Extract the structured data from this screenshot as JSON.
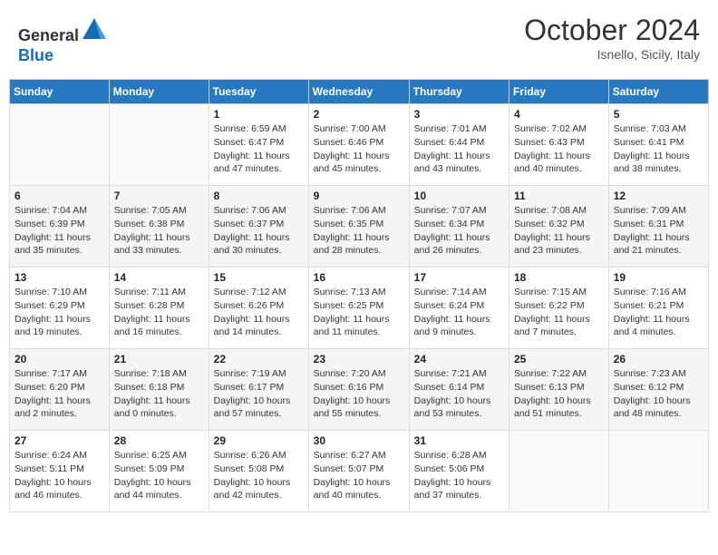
{
  "header": {
    "logo_line1": "General",
    "logo_line2": "Blue",
    "month": "October 2024",
    "location": "Isnello, Sicily, Italy"
  },
  "weekdays": [
    "Sunday",
    "Monday",
    "Tuesday",
    "Wednesday",
    "Thursday",
    "Friday",
    "Saturday"
  ],
  "weeks": [
    [
      {
        "day": "",
        "sunrise": "",
        "sunset": "",
        "daylight": ""
      },
      {
        "day": "",
        "sunrise": "",
        "sunset": "",
        "daylight": ""
      },
      {
        "day": "1",
        "sunrise": "Sunrise: 6:59 AM",
        "sunset": "Sunset: 6:47 PM",
        "daylight": "Daylight: 11 hours and 47 minutes."
      },
      {
        "day": "2",
        "sunrise": "Sunrise: 7:00 AM",
        "sunset": "Sunset: 6:46 PM",
        "daylight": "Daylight: 11 hours and 45 minutes."
      },
      {
        "day": "3",
        "sunrise": "Sunrise: 7:01 AM",
        "sunset": "Sunset: 6:44 PM",
        "daylight": "Daylight: 11 hours and 43 minutes."
      },
      {
        "day": "4",
        "sunrise": "Sunrise: 7:02 AM",
        "sunset": "Sunset: 6:43 PM",
        "daylight": "Daylight: 11 hours and 40 minutes."
      },
      {
        "day": "5",
        "sunrise": "Sunrise: 7:03 AM",
        "sunset": "Sunset: 6:41 PM",
        "daylight": "Daylight: 11 hours and 38 minutes."
      }
    ],
    [
      {
        "day": "6",
        "sunrise": "Sunrise: 7:04 AM",
        "sunset": "Sunset: 6:39 PM",
        "daylight": "Daylight: 11 hours and 35 minutes."
      },
      {
        "day": "7",
        "sunrise": "Sunrise: 7:05 AM",
        "sunset": "Sunset: 6:38 PM",
        "daylight": "Daylight: 11 hours and 33 minutes."
      },
      {
        "day": "8",
        "sunrise": "Sunrise: 7:06 AM",
        "sunset": "Sunset: 6:37 PM",
        "daylight": "Daylight: 11 hours and 30 minutes."
      },
      {
        "day": "9",
        "sunrise": "Sunrise: 7:06 AM",
        "sunset": "Sunset: 6:35 PM",
        "daylight": "Daylight: 11 hours and 28 minutes."
      },
      {
        "day": "10",
        "sunrise": "Sunrise: 7:07 AM",
        "sunset": "Sunset: 6:34 PM",
        "daylight": "Daylight: 11 hours and 26 minutes."
      },
      {
        "day": "11",
        "sunrise": "Sunrise: 7:08 AM",
        "sunset": "Sunset: 6:32 PM",
        "daylight": "Daylight: 11 hours and 23 minutes."
      },
      {
        "day": "12",
        "sunrise": "Sunrise: 7:09 AM",
        "sunset": "Sunset: 6:31 PM",
        "daylight": "Daylight: 11 hours and 21 minutes."
      }
    ],
    [
      {
        "day": "13",
        "sunrise": "Sunrise: 7:10 AM",
        "sunset": "Sunset: 6:29 PM",
        "daylight": "Daylight: 11 hours and 19 minutes."
      },
      {
        "day": "14",
        "sunrise": "Sunrise: 7:11 AM",
        "sunset": "Sunset: 6:28 PM",
        "daylight": "Daylight: 11 hours and 16 minutes."
      },
      {
        "day": "15",
        "sunrise": "Sunrise: 7:12 AM",
        "sunset": "Sunset: 6:26 PM",
        "daylight": "Daylight: 11 hours and 14 minutes."
      },
      {
        "day": "16",
        "sunrise": "Sunrise: 7:13 AM",
        "sunset": "Sunset: 6:25 PM",
        "daylight": "Daylight: 11 hours and 11 minutes."
      },
      {
        "day": "17",
        "sunrise": "Sunrise: 7:14 AM",
        "sunset": "Sunset: 6:24 PM",
        "daylight": "Daylight: 11 hours and 9 minutes."
      },
      {
        "day": "18",
        "sunrise": "Sunrise: 7:15 AM",
        "sunset": "Sunset: 6:22 PM",
        "daylight": "Daylight: 11 hours and 7 minutes."
      },
      {
        "day": "19",
        "sunrise": "Sunrise: 7:16 AM",
        "sunset": "Sunset: 6:21 PM",
        "daylight": "Daylight: 11 hours and 4 minutes."
      }
    ],
    [
      {
        "day": "20",
        "sunrise": "Sunrise: 7:17 AM",
        "sunset": "Sunset: 6:20 PM",
        "daylight": "Daylight: 11 hours and 2 minutes."
      },
      {
        "day": "21",
        "sunrise": "Sunrise: 7:18 AM",
        "sunset": "Sunset: 6:18 PM",
        "daylight": "Daylight: 11 hours and 0 minutes."
      },
      {
        "day": "22",
        "sunrise": "Sunrise: 7:19 AM",
        "sunset": "Sunset: 6:17 PM",
        "daylight": "Daylight: 10 hours and 57 minutes."
      },
      {
        "day": "23",
        "sunrise": "Sunrise: 7:20 AM",
        "sunset": "Sunset: 6:16 PM",
        "daylight": "Daylight: 10 hours and 55 minutes."
      },
      {
        "day": "24",
        "sunrise": "Sunrise: 7:21 AM",
        "sunset": "Sunset: 6:14 PM",
        "daylight": "Daylight: 10 hours and 53 minutes."
      },
      {
        "day": "25",
        "sunrise": "Sunrise: 7:22 AM",
        "sunset": "Sunset: 6:13 PM",
        "daylight": "Daylight: 10 hours and 51 minutes."
      },
      {
        "day": "26",
        "sunrise": "Sunrise: 7:23 AM",
        "sunset": "Sunset: 6:12 PM",
        "daylight": "Daylight: 10 hours and 48 minutes."
      }
    ],
    [
      {
        "day": "27",
        "sunrise": "Sunrise: 6:24 AM",
        "sunset": "Sunset: 5:11 PM",
        "daylight": "Daylight: 10 hours and 46 minutes."
      },
      {
        "day": "28",
        "sunrise": "Sunrise: 6:25 AM",
        "sunset": "Sunset: 5:09 PM",
        "daylight": "Daylight: 10 hours and 44 minutes."
      },
      {
        "day": "29",
        "sunrise": "Sunrise: 6:26 AM",
        "sunset": "Sunset: 5:08 PM",
        "daylight": "Daylight: 10 hours and 42 minutes."
      },
      {
        "day": "30",
        "sunrise": "Sunrise: 6:27 AM",
        "sunset": "Sunset: 5:07 PM",
        "daylight": "Daylight: 10 hours and 40 minutes."
      },
      {
        "day": "31",
        "sunrise": "Sunrise: 6:28 AM",
        "sunset": "Sunset: 5:06 PM",
        "daylight": "Daylight: 10 hours and 37 minutes."
      },
      {
        "day": "",
        "sunrise": "",
        "sunset": "",
        "daylight": ""
      },
      {
        "day": "",
        "sunrise": "",
        "sunset": "",
        "daylight": ""
      }
    ]
  ]
}
